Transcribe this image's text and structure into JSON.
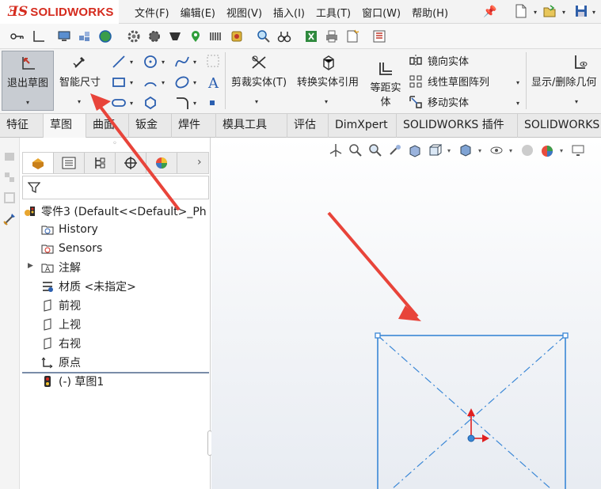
{
  "app": {
    "logo_prefix": "ƎS",
    "logo_text": "SOLIDWORKS"
  },
  "menu": [
    "文件(F)",
    "编辑(E)",
    "视图(V)",
    "插入(I)",
    "工具(T)",
    "窗口(W)",
    "帮助(H)"
  ],
  "command_manager": {
    "exit_sketch": "退出草图",
    "smart_dimension": "智能尺寸",
    "trim_entities": "剪裁实体(T)",
    "convert_entities": "转换实体引用",
    "offset_entities_line1": "等距实",
    "offset_entities_line2": "体",
    "mirror_entities": "镜向实体",
    "linear_pattern": "线性草图阵列",
    "move_entities": "移动实体",
    "display_delete_relations": "显示/删除几何"
  },
  "tabs": [
    "特征",
    "草图",
    "曲面",
    "钣金",
    "焊件",
    "模具工具",
    "评估",
    "DimXpert",
    "SOLIDWORKS 插件",
    "SOLIDWORKS"
  ],
  "active_tab": "草图",
  "tree": {
    "part": "零件3  (Default<<Default>_Ph",
    "history": "History",
    "sensors": "Sensors",
    "annotations": "注解",
    "material": "材质 <未指定>",
    "front_plane": "前视",
    "top_plane": "上视",
    "right_plane": "右视",
    "origin": "原点",
    "sketch": "(-) 草图1"
  },
  "colors": {
    "accent_red": "#d52b1e",
    "sketch_blue": "#3a87d6",
    "arrow_red": "#e8443a"
  }
}
